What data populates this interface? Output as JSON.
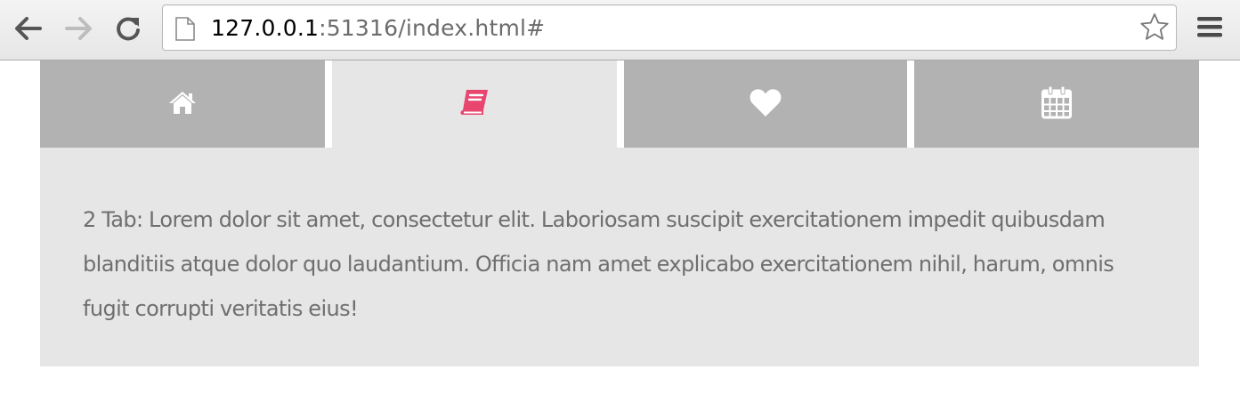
{
  "browser": {
    "url_host": "127.0.0.1",
    "url_rest": ":51316/index.html#",
    "icons": {
      "back": "back-arrow-icon",
      "forward": "forward-arrow-icon",
      "reload": "reload-icon",
      "page": "page-icon",
      "bookmark": "star-icon",
      "menu": "menu-icon"
    }
  },
  "tabs": {
    "items": [
      {
        "icon": "home-icon",
        "active": false
      },
      {
        "icon": "book-icon",
        "active": true
      },
      {
        "icon": "heart-icon",
        "active": false
      },
      {
        "icon": "calendar-icon",
        "active": false
      }
    ],
    "colors": {
      "inactive_bg": "#b2b2b2",
      "active_bg": "#e6e6e6",
      "inactive_icon": "#ffffff",
      "active_icon": "#e8456f"
    }
  },
  "panel": {
    "text": "2 Tab: Lorem dolor sit amet, consectetur elit. Laboriosam suscipit exercitationem impedit quibusdam blanditiis atque dolor quo laudantium. Officia nam amet explicabo exercitationem nihil, harum, omnis fugit corrupti veritatis eius!"
  }
}
